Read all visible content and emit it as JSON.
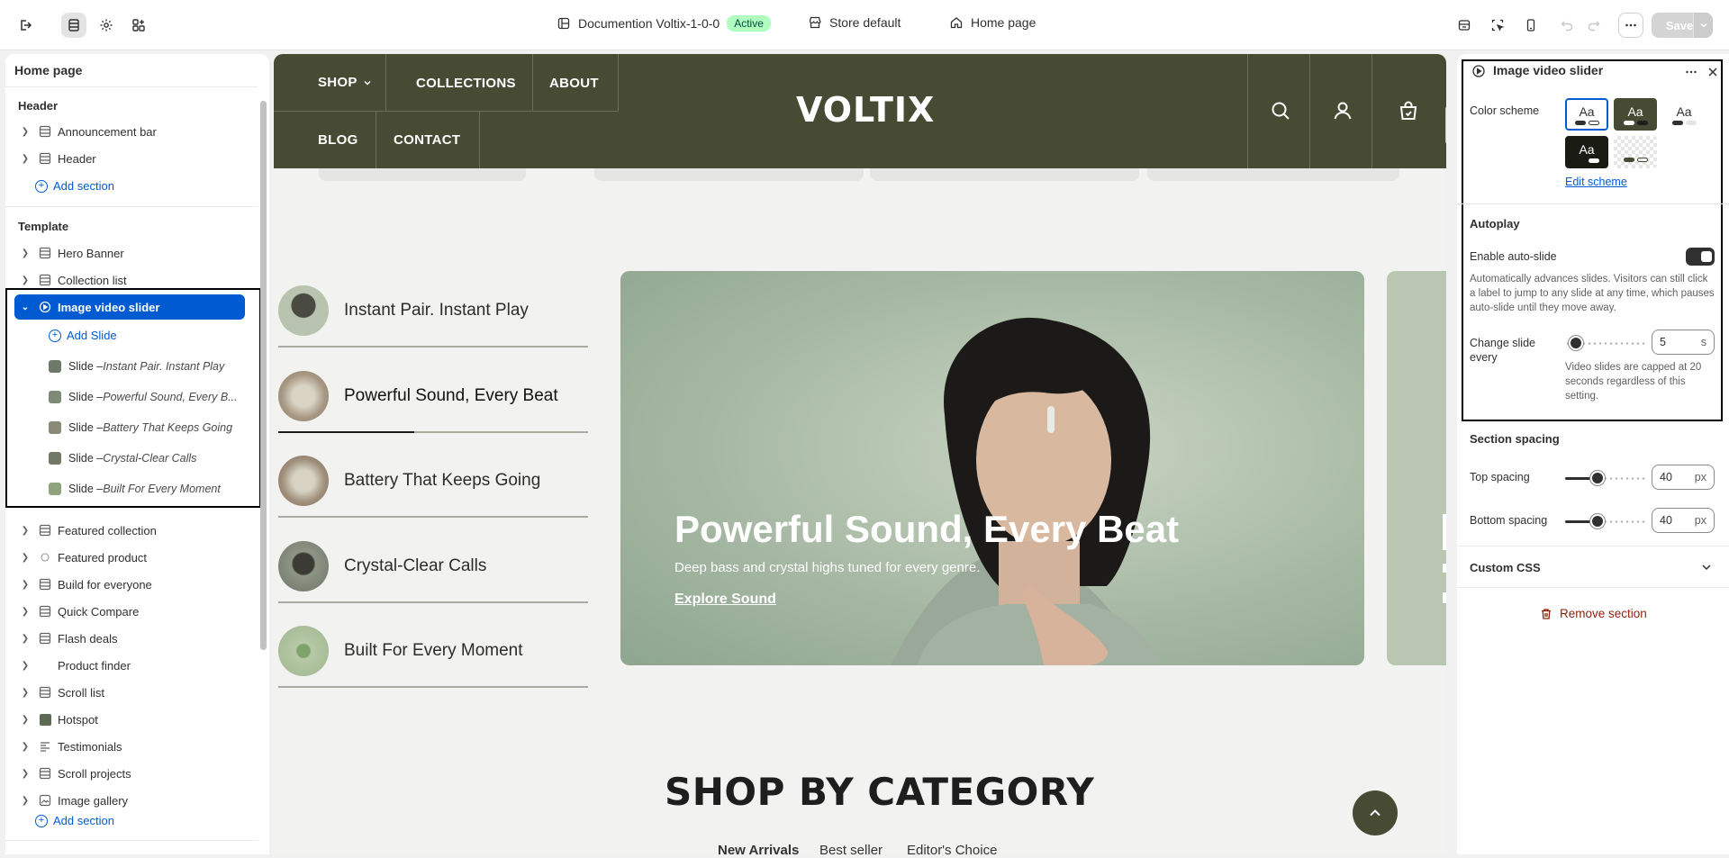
{
  "topbar": {
    "theme_name": "Documention Voltix-1-0-0",
    "status_badge": "Active",
    "store_label": "Store default",
    "page_label": "Home page",
    "save_label": "Save"
  },
  "left": {
    "title": "Home page",
    "header_group": "Header",
    "header_items": [
      {
        "label": "Announcement bar"
      },
      {
        "label": "Header"
      }
    ],
    "add_section": "Add section",
    "template_group": "Template",
    "template_items_top": [
      {
        "label": "Hero Banner"
      },
      {
        "label": "Collection list"
      }
    ],
    "selected_section": "Image video slider",
    "add_slide": "Add Slide",
    "slides": [
      {
        "prefix": "Slide – ",
        "name": "Instant Pair. Instant Play"
      },
      {
        "prefix": "Slide – ",
        "name": "Powerful Sound, Every B..."
      },
      {
        "prefix": "Slide – ",
        "name": "Battery That Keeps Going"
      },
      {
        "prefix": "Slide – ",
        "name": "Crystal-Clear Calls"
      },
      {
        "prefix": "Slide – ",
        "name": "Built For Every Moment"
      }
    ],
    "template_items_bottom": [
      {
        "label": "Featured collection"
      },
      {
        "label": "Featured product"
      },
      {
        "label": "Build for everyone"
      },
      {
        "label": "Quick Compare"
      },
      {
        "label": "Flash deals"
      },
      {
        "label": "Product finder"
      },
      {
        "label": "Scroll list"
      },
      {
        "label": "Hotspot"
      },
      {
        "label": "Testimonials"
      },
      {
        "label": "Scroll projects"
      },
      {
        "label": "Image gallery"
      }
    ],
    "add_section_2": "Add section"
  },
  "preview": {
    "nav": [
      "SHOP",
      "COLLECTIONS",
      "ABOUT",
      "BLOG",
      "CONTACT"
    ],
    "logo": "VOLTIX",
    "slide_tabs": [
      "Instant Pair. Instant Play",
      "Powerful Sound, Every Beat",
      "Battery That Keeps Going",
      "Crystal-Clear Calls",
      "Built For Every Moment"
    ],
    "active_slide_progress": 0.44,
    "hero": {
      "title": "Powerful Sound, Every Beat",
      "subtitle": "Deep bass and crystal highs tuned for every genre.",
      "link": "Explore Sound"
    },
    "shop_by_category": "SHOP BY CATEGORY",
    "category_tabs": [
      "New Arrivals",
      "Best seller",
      "Editor's Choice"
    ]
  },
  "right": {
    "title": "Image video slider",
    "color_scheme_label": "Color scheme",
    "swatch_text": "Aa",
    "edit_scheme": "Edit scheme",
    "autoplay_head": "Autoplay",
    "enable_auto_slide": "Enable auto-slide",
    "auto_slide_enabled": true,
    "auto_slide_help": "Automatically advances slides. Visitors can still click a label to jump to any slide at any time, which pauses auto-slide until they move away.",
    "change_slide_label": "Change slide every",
    "change_slide_value": "5",
    "change_slide_unit": "s",
    "video_help": "Video slides are capped at 20 seconds regardless of this setting.",
    "section_spacing_head": "Section spacing",
    "top_spacing_label": "Top spacing",
    "top_spacing_value": "40",
    "bottom_spacing_label": "Bottom spacing",
    "bottom_spacing_value": "40",
    "spacing_unit": "px",
    "custom_css": "Custom CSS",
    "remove_section": "Remove section"
  },
  "colors": {
    "accent_blue": "#005bd3",
    "store_header": "#474b34",
    "remove_red": "#8e1f0b"
  }
}
